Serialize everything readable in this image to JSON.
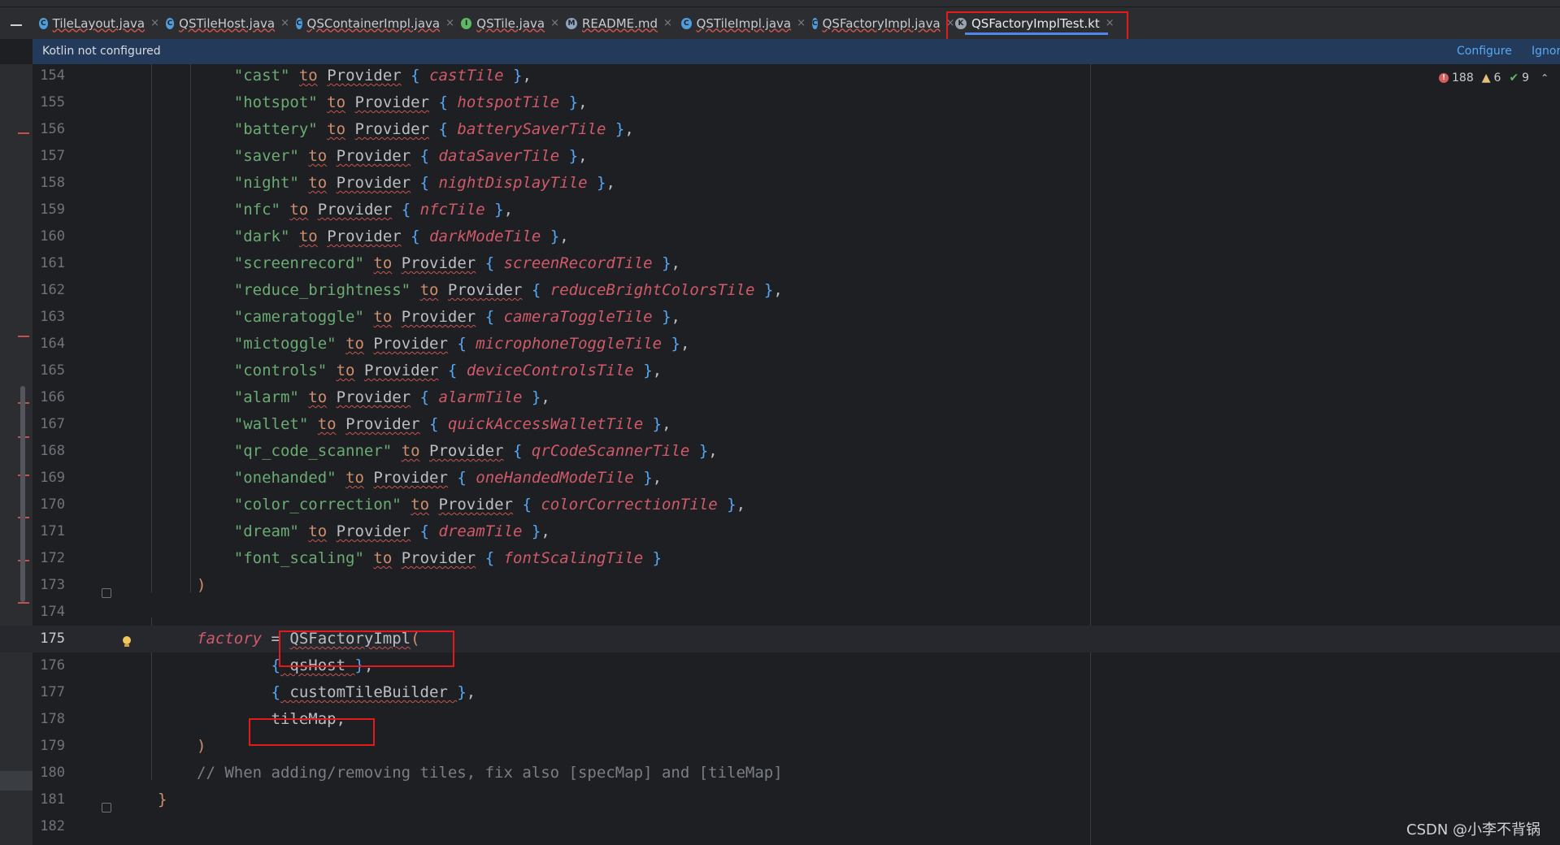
{
  "tabs": [
    {
      "label": "TileLayout.java",
      "icon": "java-class-icon",
      "color": "#4f9ddb",
      "glyph": "C"
    },
    {
      "label": "QSTileHost.java",
      "icon": "java-class-icon",
      "color": "#4f9ddb",
      "glyph": "C"
    },
    {
      "label": "QSContainerImpl.java",
      "icon": "java-class-icon",
      "color": "#4f9ddb",
      "glyph": "C"
    },
    {
      "label": "QSTile.java",
      "icon": "java-interface-icon",
      "color": "#5fb865",
      "glyph": "I"
    },
    {
      "label": "README.md",
      "icon": "markdown-file-icon",
      "color": "#8fa3bf",
      "glyph": "M"
    },
    {
      "label": "QSTileImpl.java",
      "icon": "java-abstract-class-icon",
      "color": "#4f9ddb",
      "glyph": "C"
    },
    {
      "label": "QSFactoryImpl.java",
      "icon": "java-class-icon",
      "color": "#4f9ddb",
      "glyph": "C"
    },
    {
      "label": "QSFactoryImplTest.kt",
      "icon": "kotlin-test-file-icon",
      "color": "#9aa3ad",
      "glyph": "K"
    }
  ],
  "active_tab": "QSFactoryImplTest.kt",
  "notification": {
    "message": "Kotlin not configured",
    "configure": "Configure",
    "ignore": "Ignor"
  },
  "inspections": {
    "errors": "188",
    "warnings": "6",
    "weak_warnings": "9"
  },
  "watermark": "CSDN @小李不背锅",
  "lines": [
    {
      "n": "154",
      "tokens": [
        [
          "    ",
          "pc"
        ],
        [
          "\"cast\"",
          "s"
        ],
        [
          " ",
          "pc"
        ],
        [
          "to",
          "kw"
        ],
        [
          " ",
          "pc"
        ],
        [
          "Provider",
          "id"
        ],
        [
          " ",
          "pc"
        ],
        [
          "{",
          "br"
        ],
        [
          " ",
          "pc"
        ],
        [
          "castTile",
          "it"
        ],
        [
          " ",
          "pc"
        ],
        [
          "}",
          "br"
        ],
        [
          ",",
          "pc"
        ]
      ]
    },
    {
      "n": "155",
      "tokens": [
        [
          "    ",
          "pc"
        ],
        [
          "\"hotspot\"",
          "s"
        ],
        [
          " ",
          "pc"
        ],
        [
          "to",
          "kw"
        ],
        [
          " ",
          "pc"
        ],
        [
          "Provider",
          "id"
        ],
        [
          " ",
          "pc"
        ],
        [
          "{",
          "br"
        ],
        [
          " ",
          "pc"
        ],
        [
          "hotspotTile",
          "it"
        ],
        [
          " ",
          "pc"
        ],
        [
          "}",
          "br"
        ],
        [
          ",",
          "pc"
        ]
      ]
    },
    {
      "n": "156",
      "tokens": [
        [
          "    ",
          "pc"
        ],
        [
          "\"battery\"",
          "s"
        ],
        [
          " ",
          "pc"
        ],
        [
          "to",
          "kw"
        ],
        [
          " ",
          "pc"
        ],
        [
          "Provider",
          "id"
        ],
        [
          " ",
          "pc"
        ],
        [
          "{",
          "br"
        ],
        [
          " ",
          "pc"
        ],
        [
          "batterySaverTile",
          "it"
        ],
        [
          " ",
          "pc"
        ],
        [
          "}",
          "br"
        ],
        [
          ",",
          "pc"
        ]
      ]
    },
    {
      "n": "157",
      "tokens": [
        [
          "    ",
          "pc"
        ],
        [
          "\"saver\"",
          "s"
        ],
        [
          " ",
          "pc"
        ],
        [
          "to",
          "kw"
        ],
        [
          " ",
          "pc"
        ],
        [
          "Provider",
          "id"
        ],
        [
          " ",
          "pc"
        ],
        [
          "{",
          "br"
        ],
        [
          " ",
          "pc"
        ],
        [
          "dataSaverTile",
          "it"
        ],
        [
          " ",
          "pc"
        ],
        [
          "}",
          "br"
        ],
        [
          ",",
          "pc"
        ]
      ]
    },
    {
      "n": "158",
      "tokens": [
        [
          "    ",
          "pc"
        ],
        [
          "\"night\"",
          "s"
        ],
        [
          " ",
          "pc"
        ],
        [
          "to",
          "kw"
        ],
        [
          " ",
          "pc"
        ],
        [
          "Provider",
          "id"
        ],
        [
          " ",
          "pc"
        ],
        [
          "{",
          "br"
        ],
        [
          " ",
          "pc"
        ],
        [
          "nightDisplayTile",
          "it"
        ],
        [
          " ",
          "pc"
        ],
        [
          "}",
          "br"
        ],
        [
          ",",
          "pc"
        ]
      ]
    },
    {
      "n": "159",
      "tokens": [
        [
          "    ",
          "pc"
        ],
        [
          "\"nfc\"",
          "s"
        ],
        [
          " ",
          "pc"
        ],
        [
          "to",
          "kw"
        ],
        [
          " ",
          "pc"
        ],
        [
          "Provider",
          "id"
        ],
        [
          " ",
          "pc"
        ],
        [
          "{",
          "br"
        ],
        [
          " ",
          "pc"
        ],
        [
          "nfcTile",
          "it"
        ],
        [
          " ",
          "pc"
        ],
        [
          "}",
          "br"
        ],
        [
          ",",
          "pc"
        ]
      ]
    },
    {
      "n": "160",
      "tokens": [
        [
          "    ",
          "pc"
        ],
        [
          "\"dark\"",
          "s"
        ],
        [
          " ",
          "pc"
        ],
        [
          "to",
          "kw"
        ],
        [
          " ",
          "pc"
        ],
        [
          "Provider",
          "id"
        ],
        [
          " ",
          "pc"
        ],
        [
          "{",
          "br"
        ],
        [
          " ",
          "pc"
        ],
        [
          "darkModeTile",
          "it"
        ],
        [
          " ",
          "pc"
        ],
        [
          "}",
          "br"
        ],
        [
          ",",
          "pc"
        ]
      ]
    },
    {
      "n": "161",
      "tokens": [
        [
          "    ",
          "pc"
        ],
        [
          "\"screenrecord\"",
          "s"
        ],
        [
          " ",
          "pc"
        ],
        [
          "to",
          "kw"
        ],
        [
          " ",
          "pc"
        ],
        [
          "Provider",
          "id"
        ],
        [
          " ",
          "pc"
        ],
        [
          "{",
          "br"
        ],
        [
          " ",
          "pc"
        ],
        [
          "screenRecordTile",
          "it"
        ],
        [
          " ",
          "pc"
        ],
        [
          "}",
          "br"
        ],
        [
          ",",
          "pc"
        ]
      ]
    },
    {
      "n": "162",
      "tokens": [
        [
          "    ",
          "pc"
        ],
        [
          "\"reduce_brightness\"",
          "s"
        ],
        [
          " ",
          "pc"
        ],
        [
          "to",
          "kw"
        ],
        [
          " ",
          "pc"
        ],
        [
          "Provider",
          "id"
        ],
        [
          " ",
          "pc"
        ],
        [
          "{",
          "br"
        ],
        [
          " ",
          "pc"
        ],
        [
          "reduceBrightColorsTile",
          "it"
        ],
        [
          " ",
          "pc"
        ],
        [
          "}",
          "br"
        ],
        [
          ",",
          "pc"
        ]
      ]
    },
    {
      "n": "163",
      "tokens": [
        [
          "    ",
          "pc"
        ],
        [
          "\"cameratoggle\"",
          "s"
        ],
        [
          " ",
          "pc"
        ],
        [
          "to",
          "kw"
        ],
        [
          " ",
          "pc"
        ],
        [
          "Provider",
          "id"
        ],
        [
          " ",
          "pc"
        ],
        [
          "{",
          "br"
        ],
        [
          " ",
          "pc"
        ],
        [
          "cameraToggleTile",
          "it"
        ],
        [
          " ",
          "pc"
        ],
        [
          "}",
          "br"
        ],
        [
          ",",
          "pc"
        ]
      ]
    },
    {
      "n": "164",
      "tokens": [
        [
          "    ",
          "pc"
        ],
        [
          "\"mictoggle\"",
          "s"
        ],
        [
          " ",
          "pc"
        ],
        [
          "to",
          "kw"
        ],
        [
          " ",
          "pc"
        ],
        [
          "Provider",
          "id"
        ],
        [
          " ",
          "pc"
        ],
        [
          "{",
          "br"
        ],
        [
          " ",
          "pc"
        ],
        [
          "microphoneToggleTile",
          "it"
        ],
        [
          " ",
          "pc"
        ],
        [
          "}",
          "br"
        ],
        [
          ",",
          "pc"
        ]
      ]
    },
    {
      "n": "165",
      "tokens": [
        [
          "    ",
          "pc"
        ],
        [
          "\"controls\"",
          "s"
        ],
        [
          " ",
          "pc"
        ],
        [
          "to",
          "kw"
        ],
        [
          " ",
          "pc"
        ],
        [
          "Provider",
          "id"
        ],
        [
          " ",
          "pc"
        ],
        [
          "{",
          "br"
        ],
        [
          " ",
          "pc"
        ],
        [
          "deviceControlsTile",
          "it"
        ],
        [
          " ",
          "pc"
        ],
        [
          "}",
          "br"
        ],
        [
          ",",
          "pc"
        ]
      ]
    },
    {
      "n": "166",
      "tokens": [
        [
          "    ",
          "pc"
        ],
        [
          "\"alarm\"",
          "s"
        ],
        [
          " ",
          "pc"
        ],
        [
          "to",
          "kw"
        ],
        [
          " ",
          "pc"
        ],
        [
          "Provider",
          "id"
        ],
        [
          " ",
          "pc"
        ],
        [
          "{",
          "br"
        ],
        [
          " ",
          "pc"
        ],
        [
          "alarmTile",
          "it"
        ],
        [
          " ",
          "pc"
        ],
        [
          "}",
          "br"
        ],
        [
          ",",
          "pc"
        ]
      ]
    },
    {
      "n": "167",
      "tokens": [
        [
          "    ",
          "pc"
        ],
        [
          "\"wallet\"",
          "s"
        ],
        [
          " ",
          "pc"
        ],
        [
          "to",
          "kw"
        ],
        [
          " ",
          "pc"
        ],
        [
          "Provider",
          "id"
        ],
        [
          " ",
          "pc"
        ],
        [
          "{",
          "br"
        ],
        [
          " ",
          "pc"
        ],
        [
          "quickAccessWalletTile",
          "it"
        ],
        [
          " ",
          "pc"
        ],
        [
          "}",
          "br"
        ],
        [
          ",",
          "pc"
        ]
      ]
    },
    {
      "n": "168",
      "tokens": [
        [
          "    ",
          "pc"
        ],
        [
          "\"qr_code_scanner\"",
          "s"
        ],
        [
          " ",
          "pc"
        ],
        [
          "to",
          "kw"
        ],
        [
          " ",
          "pc"
        ],
        [
          "Provider",
          "id"
        ],
        [
          " ",
          "pc"
        ],
        [
          "{",
          "br"
        ],
        [
          " ",
          "pc"
        ],
        [
          "qrCodeScannerTile",
          "it"
        ],
        [
          " ",
          "pc"
        ],
        [
          "}",
          "br"
        ],
        [
          ",",
          "pc"
        ]
      ]
    },
    {
      "n": "169",
      "tokens": [
        [
          "    ",
          "pc"
        ],
        [
          "\"onehanded\"",
          "s"
        ],
        [
          " ",
          "pc"
        ],
        [
          "to",
          "kw"
        ],
        [
          " ",
          "pc"
        ],
        [
          "Provider",
          "id"
        ],
        [
          " ",
          "pc"
        ],
        [
          "{",
          "br"
        ],
        [
          " ",
          "pc"
        ],
        [
          "oneHandedModeTile",
          "it"
        ],
        [
          " ",
          "pc"
        ],
        [
          "}",
          "br"
        ],
        [
          ",",
          "pc"
        ]
      ]
    },
    {
      "n": "170",
      "tokens": [
        [
          "    ",
          "pc"
        ],
        [
          "\"color_correction\"",
          "s"
        ],
        [
          " ",
          "pc"
        ],
        [
          "to",
          "kw"
        ],
        [
          " ",
          "pc"
        ],
        [
          "Provider",
          "id"
        ],
        [
          " ",
          "pc"
        ],
        [
          "{",
          "br"
        ],
        [
          " ",
          "pc"
        ],
        [
          "colorCorrectionTile",
          "it"
        ],
        [
          " ",
          "pc"
        ],
        [
          "}",
          "br"
        ],
        [
          ",",
          "pc"
        ]
      ]
    },
    {
      "n": "171",
      "tokens": [
        [
          "    ",
          "pc"
        ],
        [
          "\"dream\"",
          "s"
        ],
        [
          " ",
          "pc"
        ],
        [
          "to",
          "kw"
        ],
        [
          " ",
          "pc"
        ],
        [
          "Provider",
          "id"
        ],
        [
          " ",
          "pc"
        ],
        [
          "{",
          "br"
        ],
        [
          " ",
          "pc"
        ],
        [
          "dreamTile",
          "it"
        ],
        [
          " ",
          "pc"
        ],
        [
          "}",
          "br"
        ],
        [
          ",",
          "pc"
        ]
      ]
    },
    {
      "n": "172",
      "tokens": [
        [
          "    ",
          "pc"
        ],
        [
          "\"font_scaling\"",
          "s"
        ],
        [
          " ",
          "pc"
        ],
        [
          "to",
          "kw"
        ],
        [
          " ",
          "pc"
        ],
        [
          "Provider",
          "id"
        ],
        [
          " ",
          "pc"
        ],
        [
          "{",
          "br"
        ],
        [
          " ",
          "pc"
        ],
        [
          "fontScalingTile",
          "it"
        ],
        [
          " ",
          "pc"
        ],
        [
          "}",
          "br"
        ]
      ]
    },
    {
      "n": "173",
      "tokens": [
        [
          ")",
          "kw"
        ]
      ]
    },
    {
      "n": "174",
      "tokens": []
    },
    {
      "n": "175",
      "tokens": [
        [
          "factory",
          "it"
        ],
        [
          " = ",
          "pc"
        ],
        [
          "QSFactoryImpl",
          "id"
        ],
        [
          "(",
          "kw"
        ]
      ]
    },
    {
      "n": "176",
      "tokens": [
        [
          "        ",
          "pc"
        ],
        [
          "{",
          "br"
        ],
        [
          " qsHost ",
          "id"
        ],
        [
          "}",
          "br"
        ],
        [
          ",",
          "pc"
        ]
      ]
    },
    {
      "n": "177",
      "tokens": [
        [
          "        ",
          "pc"
        ],
        [
          "{",
          "br"
        ],
        [
          " customTileBuilder ",
          "id"
        ],
        [
          "}",
          "br"
        ],
        [
          ",",
          "pc"
        ]
      ]
    },
    {
      "n": "178",
      "tokens": [
        [
          "        ",
          "pc"
        ],
        [
          "tileMap",
          "id"
        ],
        [
          ",",
          "pc"
        ]
      ]
    },
    {
      "n": "179",
      "tokens": [
        [
          ")",
          "kw"
        ]
      ]
    },
    {
      "n": "180",
      "tokens": [
        [
          "// When adding/removing tiles, fix also [specMap] and [tileMap]",
          "cm"
        ]
      ]
    },
    {
      "n": "181",
      "tokens": [
        [
          "}",
          "kw"
        ]
      ]
    },
    {
      "n": "182",
      "tokens": []
    }
  ]
}
